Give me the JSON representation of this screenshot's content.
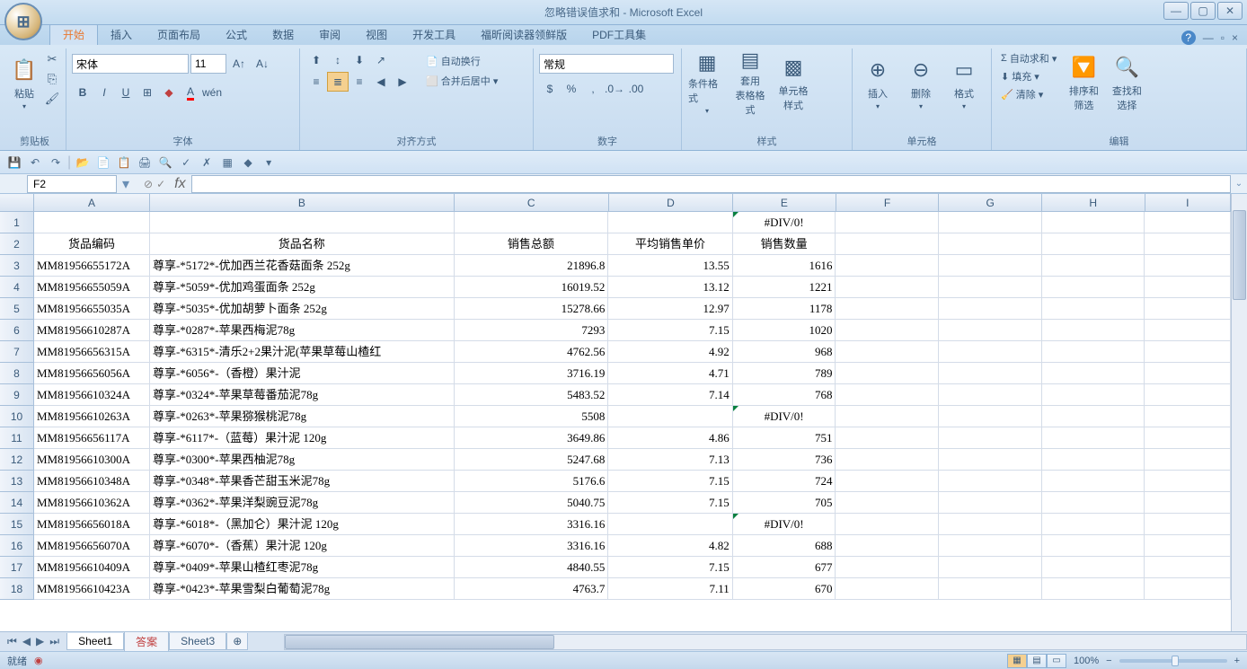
{
  "title": "忽略错误值求和 - Microsoft Excel",
  "window": {
    "min": "—",
    "max": "▢",
    "close": "✕"
  },
  "tabs": [
    "开始",
    "插入",
    "页面布局",
    "公式",
    "数据",
    "审阅",
    "视图",
    "开发工具",
    "福昕阅读器领鲜版",
    "PDF工具集"
  ],
  "ribbon_help": "?",
  "groups": {
    "clipboard": {
      "label": "剪贴板",
      "paste": "粘贴"
    },
    "font": {
      "label": "字体",
      "name": "宋体",
      "size": "11"
    },
    "align": {
      "label": "对齐方式",
      "wrap": "自动换行",
      "merge": "合并后居中"
    },
    "number": {
      "label": "数字",
      "format": "常规"
    },
    "styles": {
      "label": "样式",
      "cond": "条件格式",
      "table": "套用\n表格格式",
      "cell": "单元格\n样式"
    },
    "cells": {
      "label": "单元格",
      "insert": "插入",
      "delete": "删除",
      "format": "格式"
    },
    "edit": {
      "label": "编辑",
      "sum": "自动求和",
      "fill": "填充",
      "clear": "清除",
      "sort": "排序和\n筛选",
      "find": "查找和\n选择"
    }
  },
  "name_box": "F2",
  "columns": [
    "A",
    "B",
    "C",
    "D",
    "E",
    "F",
    "G",
    "H",
    "I"
  ],
  "headers": {
    "a": "货品编码",
    "b": "货品名称",
    "c": "销售总额",
    "d": "平均销售单价",
    "e": "销售数量"
  },
  "e1": "#DIV/0!",
  "rows": [
    {
      "a": "MM81956655172A",
      "b": "尊享-*5172*-优加西兰花香菇面条 252g",
      "c": "21896.8",
      "d": "13.55",
      "e": "1616"
    },
    {
      "a": "MM81956655059A",
      "b": "尊享-*5059*-优加鸡蛋面条 252g",
      "c": "16019.52",
      "d": "13.12",
      "e": "1221"
    },
    {
      "a": "MM81956655035A",
      "b": "尊享-*5035*-优加胡萝卜面条 252g",
      "c": "15278.66",
      "d": "12.97",
      "e": "1178"
    },
    {
      "a": "MM81956610287A",
      "b": "尊享-*0287*-苹果西梅泥78g",
      "c": "7293",
      "d": "7.15",
      "e": "1020"
    },
    {
      "a": "MM81956656315A",
      "b": "尊享-*6315*-清乐2+2果汁泥(苹果草莓山楂红",
      "c": "4762.56",
      "d": "4.92",
      "e": "968"
    },
    {
      "a": "MM81956656056A",
      "b": "尊享-*6056*-（香橙）果汁泥",
      "c": "3716.19",
      "d": "4.71",
      "e": "789"
    },
    {
      "a": "MM81956610324A",
      "b": "尊享-*0324*-苹果草莓番茄泥78g",
      "c": "5483.52",
      "d": "7.14",
      "e": "768"
    },
    {
      "a": "MM81956610263A",
      "b": "尊享-*0263*-苹果猕猴桃泥78g",
      "c": "5508",
      "d": "",
      "e": "#DIV/0!",
      "err": true
    },
    {
      "a": "MM81956656117A",
      "b": "尊享-*6117*-（蓝莓）果汁泥 120g",
      "c": "3649.86",
      "d": "4.86",
      "e": "751"
    },
    {
      "a": "MM81956610300A",
      "b": "尊享-*0300*-苹果西柚泥78g",
      "c": "5247.68",
      "d": "7.13",
      "e": "736"
    },
    {
      "a": "MM81956610348A",
      "b": "尊享-*0348*-苹果香芒甜玉米泥78g",
      "c": "5176.6",
      "d": "7.15",
      "e": "724"
    },
    {
      "a": "MM81956610362A",
      "b": "尊享-*0362*-苹果洋梨豌豆泥78g",
      "c": "5040.75",
      "d": "7.15",
      "e": "705"
    },
    {
      "a": "MM81956656018A",
      "b": "尊享-*6018*-（黑加仑）果汁泥 120g",
      "c": "3316.16",
      "d": "",
      "e": "#DIV/0!",
      "err": true
    },
    {
      "a": "MM81956656070A",
      "b": "尊享-*6070*-（香蕉）果汁泥 120g",
      "c": "3316.16",
      "d": "4.82",
      "e": "688"
    },
    {
      "a": "MM81956610409A",
      "b": "尊享-*0409*-苹果山楂红枣泥78g",
      "c": "4840.55",
      "d": "7.15",
      "e": "677"
    },
    {
      "a": "MM81956610423A",
      "b": "尊享-*0423*-苹果雪梨白葡萄泥78g",
      "c": "4763.7",
      "d": "7.11",
      "e": "670"
    }
  ],
  "sheets": [
    "Sheet1",
    "答案",
    "Sheet3"
  ],
  "status": {
    "ready": "就绪",
    "zoom": "100%"
  }
}
